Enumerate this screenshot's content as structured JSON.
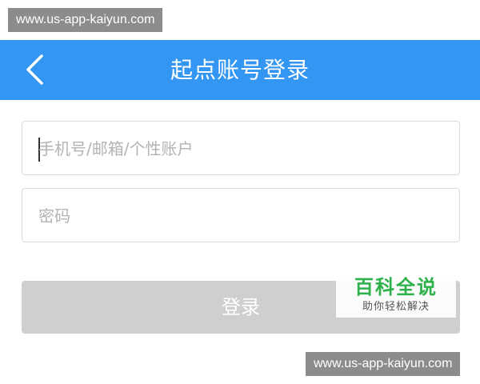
{
  "watermark": {
    "top_text": "www.us-app-kaiyun.com",
    "bottom_text": "www.us-app-kaiyun.com"
  },
  "header": {
    "title": "起点账号登录",
    "back_icon": "chevron-left-icon",
    "background_color": "#3396f3"
  },
  "form": {
    "account_placeholder": "手机号/邮箱/个性账户",
    "account_value": "",
    "password_placeholder": "密码",
    "password_value": ""
  },
  "login_button": {
    "label": "登录",
    "state": "disabled"
  },
  "brand": {
    "name": "百科全说",
    "slogan": "助你轻松解决"
  }
}
